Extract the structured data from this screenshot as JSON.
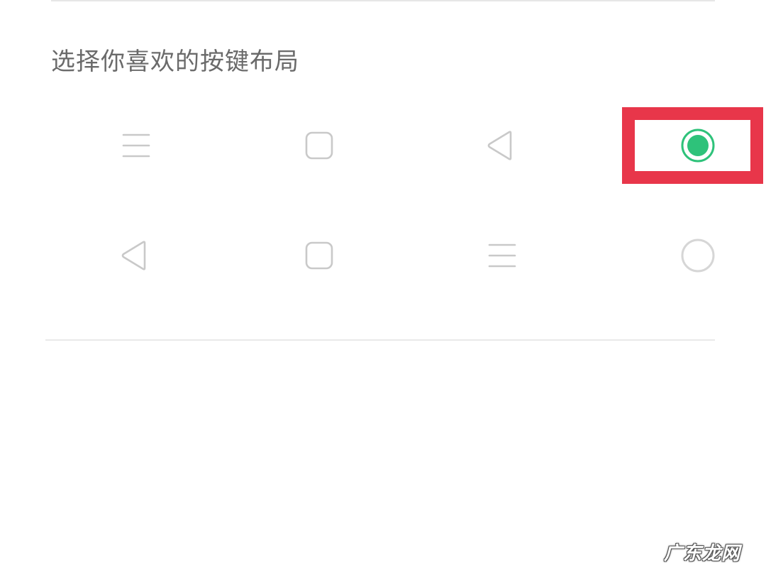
{
  "section": {
    "title": "选择你喜欢的按键布局"
  },
  "layouts": [
    {
      "id": "menu-home-back",
      "keys": [
        "menu-icon",
        "home-square-icon",
        "back-triangle-icon"
      ],
      "selected": true
    },
    {
      "id": "back-home-menu",
      "keys": [
        "back-triangle-icon",
        "home-square-icon",
        "menu-icon"
      ],
      "selected": false
    }
  ],
  "colors": {
    "icon_gray": "#c9c9c9",
    "radio_selected": "#2ec27a",
    "radio_unselected": "#d6d6d6",
    "highlight_border": "#e8364a",
    "title_text": "#6a6a6a"
  },
  "watermark": {
    "text": "广东龙网"
  }
}
